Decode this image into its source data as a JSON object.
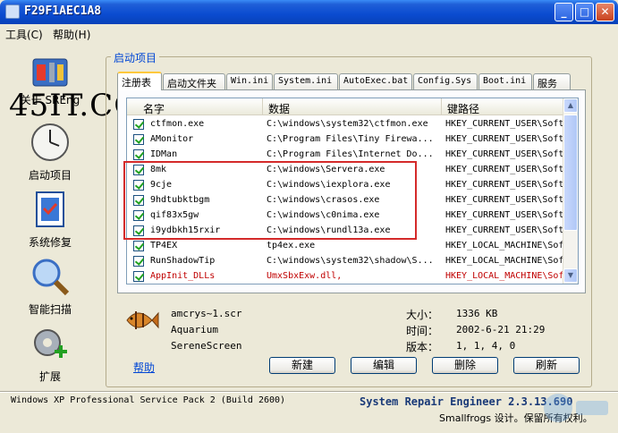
{
  "window": {
    "title": "F29F1AEC1A8"
  },
  "menu": [
    {
      "label": "工具(C)"
    },
    {
      "label": "帮助(H)"
    }
  ],
  "nav": {
    "watermark": "45IT.COM",
    "hidden_label": "关于 SREng",
    "items": [
      {
        "label": "启动项目"
      },
      {
        "label": "系统修复"
      },
      {
        "label": "智能扫描"
      },
      {
        "label": "扩展"
      }
    ]
  },
  "group": {
    "title": "启动项目"
  },
  "tabs": [
    {
      "label": "注册表"
    },
    {
      "label": "启动文件夹"
    },
    {
      "label": "Win.ini"
    },
    {
      "label": "System.ini"
    },
    {
      "label": "AutoExec.bat"
    },
    {
      "label": "Config.Sys"
    },
    {
      "label": "Boot.ini"
    },
    {
      "label": "服务"
    }
  ],
  "list": {
    "columns": [
      {
        "label": "名字"
      },
      {
        "label": "数据"
      },
      {
        "label": "键路径"
      }
    ],
    "rows": [
      {
        "name": "ctfmon.exe",
        "data": "C:\\windows\\system32\\ctfmon.exe",
        "key": "HKEY_CURRENT_USER\\Softw"
      },
      {
        "name": "AMonitor",
        "data": "C:\\Program Files\\Tiny Firewa...",
        "key": "HKEY_CURRENT_USER\\Softw"
      },
      {
        "name": "IDMan",
        "data": "C:\\Program Files\\Internet Do...",
        "key": "HKEY_CURRENT_USER\\Softw"
      },
      {
        "name": "8mk",
        "data": "C:\\windows\\Servera.exe",
        "key": "HKEY_CURRENT_USER\\Softw"
      },
      {
        "name": "9cje",
        "data": "C:\\windows\\iexplora.exe",
        "key": "HKEY_CURRENT_USER\\Softw"
      },
      {
        "name": "9hdtubktbgm",
        "data": "C:\\windows\\crasos.exe",
        "key": "HKEY_CURRENT_USER\\Softw"
      },
      {
        "name": "qif83x5gw",
        "data": "C:\\windows\\c0nima.exe",
        "key": "HKEY_CURRENT_USER\\Softw"
      },
      {
        "name": "i9ydbkh15rxir",
        "data": "C:\\windows\\rundl13a.exe",
        "key": "HKEY_CURRENT_USER\\Softw"
      },
      {
        "name": "TP4EX",
        "data": "tp4ex.exe",
        "key": "HKEY_LOCAL_MACHINE\\Sof"
      },
      {
        "name": "RunShadowTip",
        "data": "C:\\windows\\system32\\shadow\\S...",
        "key": "HKEY_LOCAL_MACHINE\\Sof"
      },
      {
        "name": "AppInit_DLLs",
        "data": "UmxSbxExw.dll,",
        "key": "HKEY_LOCAL_MACHINE\\Sof"
      }
    ]
  },
  "detail": {
    "file": "amcrys~1.scr",
    "company": "Aquarium",
    "product": "SereneScreen",
    "size_label": "大小：",
    "size": "1336 KB",
    "time_label": "时间：",
    "time": "2002-6-21 21:29",
    "version_label": "版本：",
    "version": "1, 1, 4, 0"
  },
  "buttons": {
    "help": "帮助",
    "new": "新建",
    "edit": "编辑",
    "delete": "删除",
    "refresh": "刷新"
  },
  "status": {
    "os": "Windows XP Professional Service Pack 2 (Build 2600)",
    "product": "System Repair Engineer 2.3.13.690",
    "copyright": "Smallfrogs 设计。保留所有权利。"
  },
  "colors": {
    "title_bar": "#0a4bd0",
    "link": "#0046d5",
    "highlight": "#d42a2a",
    "warning_text": "#c00000"
  }
}
